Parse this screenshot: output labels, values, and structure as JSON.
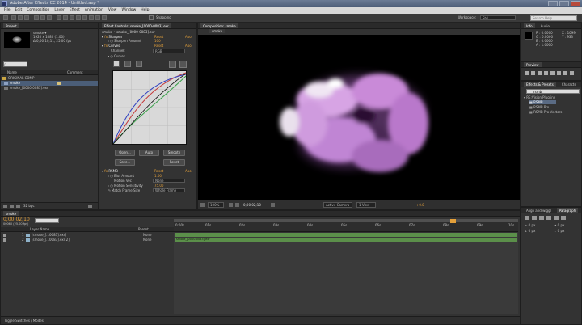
{
  "app": {
    "title": "Adobe After Effects CC 2014 - Untitled.aep *",
    "menu": [
      "File",
      "Edit",
      "Composition",
      "Layer",
      "Effect",
      "Animation",
      "View",
      "Window",
      "Help"
    ],
    "snapping": "Snapping",
    "workspace_label": "Workspace:",
    "workspace_value": "Std",
    "search_placeholder": "Search Help"
  },
  "project": {
    "tab": "Project",
    "comp_name": "smoke ▾",
    "comp_info1": "1920 x 1080 (1.00)",
    "comp_info2": "Δ 0;00;10;11, 25.00 fps",
    "search_placeholder": "ρ",
    "header_name": "Name",
    "header_comment": "Comment",
    "items": [
      {
        "name": "ORIGINAL COMP"
      },
      {
        "name": "smoke"
      },
      {
        "name": "smoke_[0000-0083].exr"
      }
    ],
    "bpc": "32 bpc"
  },
  "effect_controls": {
    "tab": "Effect Controls: smoke_[0000-0083].exr",
    "subtab": "smoke • smoke_[0000-0083].exr",
    "reset": "Reset",
    "about": "Abo",
    "sharpen": {
      "name": "Sharpen",
      "param": "Sharpen Amount",
      "value": "100"
    },
    "curves": {
      "name": "Curves",
      "channel_label": "Channel:",
      "channel_value": "RGB",
      "sub": "Curves"
    },
    "buttons": {
      "open": "Open...",
      "auto": "Auto",
      "smooth": "Smooth",
      "save": "Save...",
      "reset": "Reset"
    },
    "rsmb": {
      "name": "RSMB",
      "params": [
        {
          "label": "Blur Amount",
          "value": "1.00"
        },
        {
          "label": "Motion Vec",
          "value": "None"
        },
        {
          "label": "Motion Sensitivity",
          "value": "75.00"
        },
        {
          "label": "Match Frame Size",
          "value": "Whole Frame"
        }
      ]
    }
  },
  "composition": {
    "tab": "Composition: smoke",
    "subtab": "smoke",
    "zoom": "100%",
    "time": "0;00;02;10",
    "camera": "Active Camera",
    "views": "1 View",
    "exposure": "+0.0"
  },
  "info": {
    "tabs": [
      "Info",
      "Audio"
    ],
    "lines": [
      "R : 0.0000",
      "G : 0.0000",
      "B : 0.0000",
      "A : 1.0000"
    ],
    "coords": [
      "X : 1099",
      "Y : 933"
    ]
  },
  "preview": {
    "tab": "Preview"
  },
  "effects_presets": {
    "tabs": [
      "Effects & Presets",
      "Characte"
    ],
    "search": "rsmb",
    "group": "RE:Vision Plug-ins",
    "items": [
      "RSMB",
      "RSMB Pro",
      "RSMB Pro Vectors"
    ]
  },
  "align": {
    "tabs": [
      "Align and wiggl",
      "Paragraph"
    ]
  },
  "timeline": {
    "tab": "smoke",
    "time": "0;00;02;10",
    "frames": "00060 (25.00 fps)",
    "headers": {
      "source": "Layer Name",
      "parent": "Parent"
    },
    "layers": [
      {
        "num": "1",
        "name": "[smoke_[...0083].exr]",
        "parent": "None"
      },
      {
        "num": "2",
        "name": "[smoke_[...0083].exr 2]",
        "parent": "None"
      }
    ],
    "ruler": [
      "0:00s",
      "01s",
      "02s",
      "03s",
      "04s",
      "05s",
      "06s",
      "07s",
      "08s",
      "09s",
      "10s"
    ],
    "clip_label": "smoke_[0000-0083].exr",
    "toggle_label": "Toggle Switches / Modes",
    "playhead_fraction": 0.81
  },
  "colors": {
    "accent_orange": "#e4a03a",
    "clip_green": "#5b8f4a",
    "playhead": "#d2453c",
    "smoke": "#c98ad8"
  }
}
